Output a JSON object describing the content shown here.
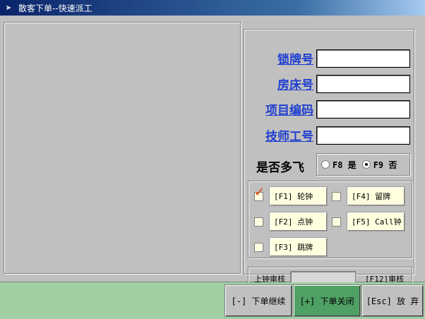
{
  "window": {
    "title": "散客下单--快速派工",
    "icon": "app-icon"
  },
  "fields": [
    {
      "label": "锁牌号",
      "value": ""
    },
    {
      "label": "房床号",
      "value": ""
    },
    {
      "label": "项目编码",
      "value": ""
    },
    {
      "label": "技师工号",
      "value": ""
    }
  ],
  "multifly": {
    "label": "是否多飞",
    "options": [
      {
        "label": "F8 是",
        "selected": false
      },
      {
        "label": "F9 否",
        "selected": true
      }
    ]
  },
  "options": [
    {
      "label": "[F1] 轮钟",
      "checked": true
    },
    {
      "label": "[F4] 留牌",
      "checked": false
    },
    {
      "label": "[F2] 点钟",
      "checked": false
    },
    {
      "label": "[F5] Call钟",
      "checked": false
    },
    {
      "label": "[F3] 跳牌",
      "checked": false
    }
  ],
  "audit": {
    "label": "上钟审核",
    "value": "",
    "key_label": "[F12]审核"
  },
  "buttons": {
    "continue": "[-] 下单继续",
    "close": "[+] 下单关闭",
    "cancel": "[Esc] 放 弃"
  },
  "colors": {
    "label_blue": "#1f3fcf",
    "bottom_bar": "#9fcfa3",
    "close_button": "#4fa064",
    "option_bg": "#ffffe0",
    "check_mark": "#e04000"
  }
}
